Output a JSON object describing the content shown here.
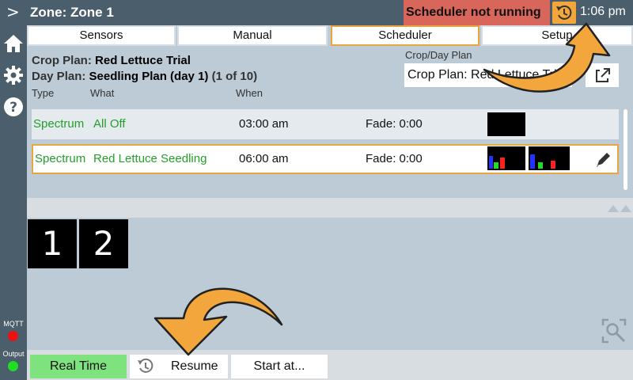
{
  "header": {
    "menu_glyph": ">",
    "zone": "Zone: Zone 1",
    "status": "Scheduler not running",
    "clock": "1:06 pm"
  },
  "sidebar": {
    "icons": [
      "home-icon",
      "gear-icon",
      "help-icon"
    ],
    "indicators": [
      {
        "label": "MQTT",
        "color": "#ee1111"
      },
      {
        "label": "Output",
        "color": "#22dd22"
      }
    ]
  },
  "tabs": [
    {
      "label": "Sensors",
      "active": false
    },
    {
      "label": "Manual",
      "active": false
    },
    {
      "label": "Scheduler",
      "active": true
    },
    {
      "label": "Setup",
      "active": false
    }
  ],
  "plan": {
    "crop_label": "Crop Plan:",
    "crop_name": "Red Lettuce Trial",
    "day_label": "Day Plan:",
    "day_name": "Seedling Plan (day 1)",
    "day_count": "(1 of 10)",
    "select_label": "Crop/Day Plan",
    "select_value": "Crop Plan: Red Lettuce Trial"
  },
  "columns": {
    "type": "Type",
    "what": "What",
    "when": "When"
  },
  "rows": [
    {
      "type": "Spectrum",
      "what": "All Off",
      "when": "03:00 am",
      "fade": "Fade: 0:00",
      "selected": false
    },
    {
      "type": "Spectrum",
      "what": "Red Lettuce Seedling",
      "when": "06:00 am",
      "fade": "Fade: 0:00",
      "selected": true
    }
  ],
  "pages": [
    "1",
    "2"
  ],
  "bottom": {
    "realtime": "Real Time",
    "resume": "Resume",
    "start_at": "Start at..."
  },
  "colors": {
    "accent": "#f3a63b",
    "status_bg": "#d9665a",
    "chrome": "#4a5e6c",
    "active_btn": "#7ee27e"
  }
}
